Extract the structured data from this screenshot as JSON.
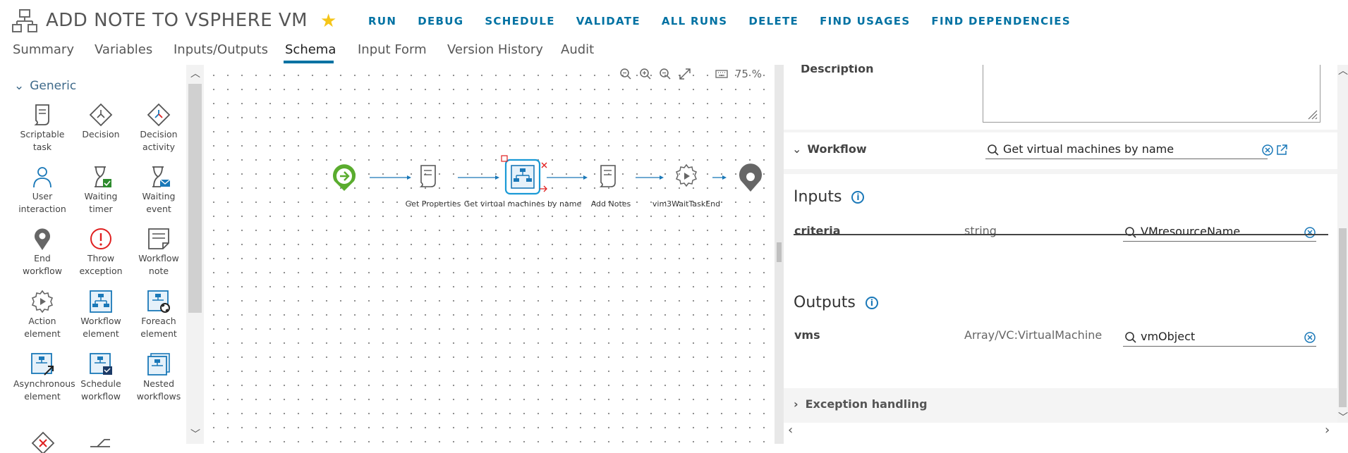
{
  "header": {
    "title": "ADD NOTE TO VSPHERE VM",
    "actions": [
      "RUN",
      "DEBUG",
      "SCHEDULE",
      "VALIDATE",
      "ALL RUNS",
      "DELETE",
      "FIND USAGES",
      "FIND DEPENDENCIES"
    ]
  },
  "tabs": [
    "Summary",
    "Variables",
    "Inputs/Outputs",
    "Schema",
    "Input Form",
    "Version History",
    "Audit"
  ],
  "active_tab": "Schema",
  "palette": {
    "section": "Generic",
    "items": [
      {
        "label": "Scriptable task",
        "icon": "scriptable-task-icon"
      },
      {
        "label": "Decision",
        "icon": "decision-icon"
      },
      {
        "label": "Decision activity",
        "icon": "decision-activity-icon"
      },
      {
        "label": "User interaction",
        "icon": "user-interaction-icon"
      },
      {
        "label": "Waiting timer",
        "icon": "waiting-timer-icon"
      },
      {
        "label": "Waiting event",
        "icon": "waiting-event-icon"
      },
      {
        "label": "End workflow",
        "icon": "end-workflow-icon"
      },
      {
        "label": "Throw exception",
        "icon": "throw-exception-icon"
      },
      {
        "label": "Workflow note",
        "icon": "workflow-note-icon"
      },
      {
        "label": "Action element",
        "icon": "action-element-icon"
      },
      {
        "label": "Workflow element",
        "icon": "workflow-element-icon"
      },
      {
        "label": "Foreach element",
        "icon": "foreach-element-icon"
      },
      {
        "label": "Asynchronous element",
        "icon": "asynchronous-element-icon"
      },
      {
        "label": "Schedule workflow",
        "icon": "schedule-workflow-icon"
      },
      {
        "label": "Nested workflows",
        "icon": "nested-workflows-icon"
      }
    ]
  },
  "canvas": {
    "zoom": "75 %",
    "nodes": [
      {
        "label": "",
        "icon": "start-icon"
      },
      {
        "label": "Get Properties",
        "icon": "scriptable-task-icon"
      },
      {
        "label": "Get virtual machines by name",
        "icon": "workflow-element-icon"
      },
      {
        "label": "Add Notes",
        "icon": "scriptable-task-icon"
      },
      {
        "label": "vim3WaitTaskEnd",
        "icon": "action-element-icon"
      },
      {
        "label": "",
        "icon": "end-icon"
      }
    ]
  },
  "properties": {
    "description_label": "Description",
    "workflow_label": "Workflow",
    "workflow_value": "Get virtual machines by name",
    "inputs_title": "Inputs",
    "inputs": [
      {
        "name": "criteria",
        "type": "string",
        "value": "VMresourceName"
      }
    ],
    "outputs_title": "Outputs",
    "outputs": [
      {
        "name": "vms",
        "type": "Array/VC:VirtualMachine",
        "value": "vmObject"
      }
    ],
    "exception_label": "Exception handling"
  },
  "colors": {
    "accent": "#0072a3",
    "start": "#5aac2e",
    "star": "#f5c518",
    "error": "#e02020"
  }
}
